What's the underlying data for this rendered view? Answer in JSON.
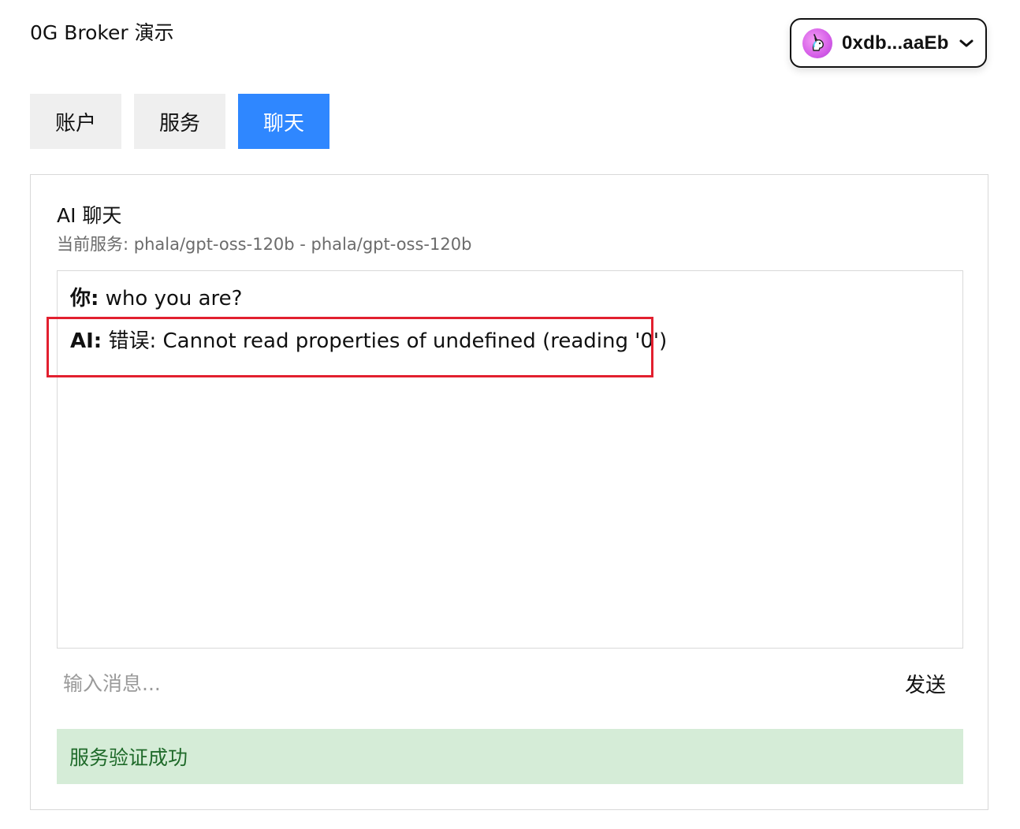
{
  "header": {
    "app_title": "0G Broker 演示",
    "wallet": {
      "address": "0xdb...aaEb",
      "avatar_icon": "unicorn-icon",
      "dropdown_icon": "chevron-down-icon"
    }
  },
  "tabs": [
    {
      "label": "账户",
      "active": false
    },
    {
      "label": "服务",
      "active": false
    },
    {
      "label": "聊天",
      "active": true
    }
  ],
  "chat": {
    "title": "AI 聊天",
    "current_service": "当前服务: phala/gpt-oss-120b - phala/gpt-oss-120b",
    "messages": [
      {
        "sender": "你:",
        "text": "who you are?"
      },
      {
        "sender": "AI:",
        "text": "错误: Cannot read properties of undefined (reading '0')"
      }
    ],
    "input": {
      "value": "",
      "placeholder": "输入消息..."
    },
    "send_label": "发送",
    "status": "服务验证成功"
  },
  "colors": {
    "accent": "#2f87ff",
    "highlight_border": "#e2202f",
    "success_bg": "#d5ecd7",
    "success_text": "#1f6a2a",
    "avatar": "#d55ee8"
  }
}
